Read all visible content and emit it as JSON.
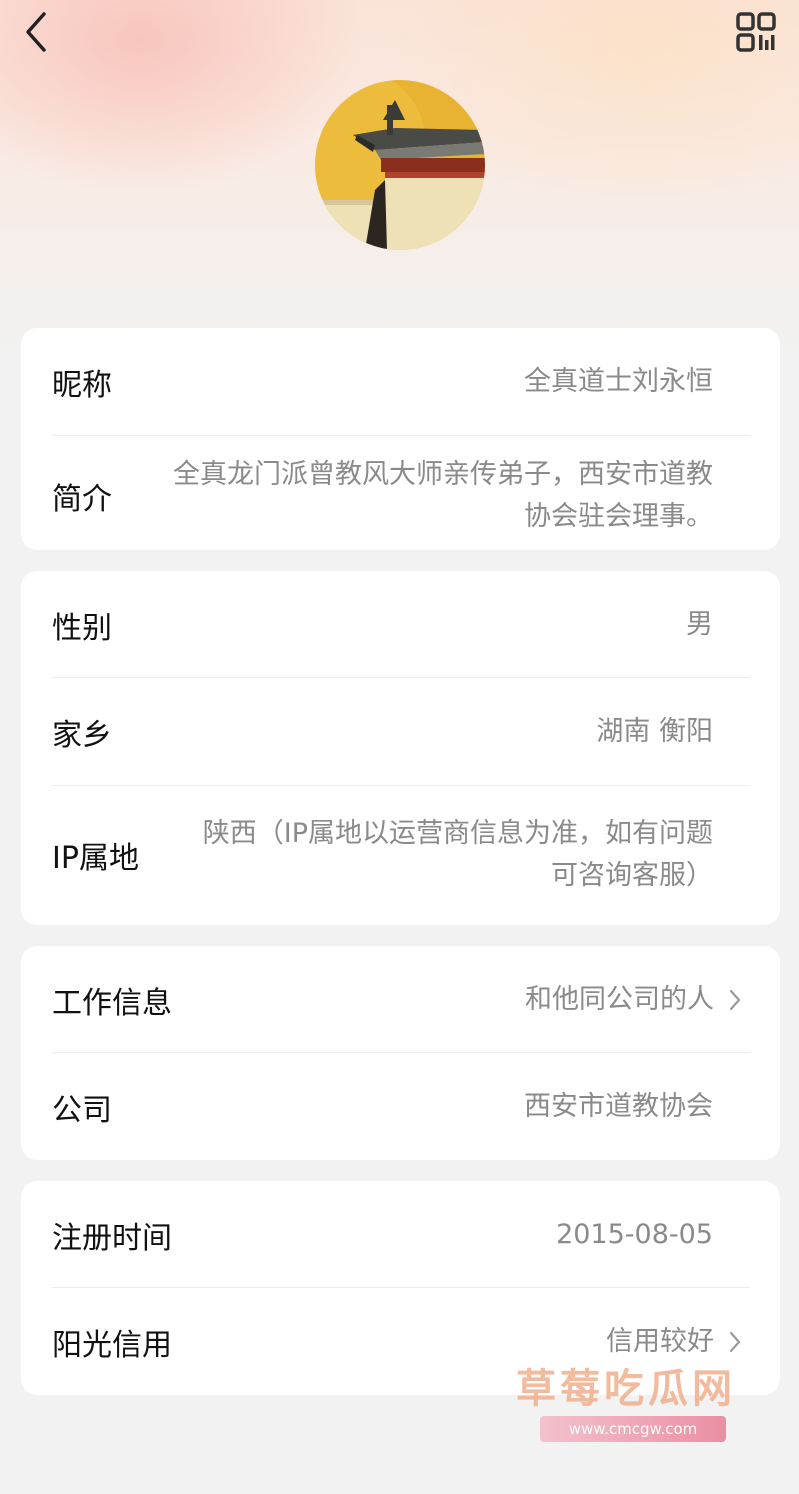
{
  "profile": {
    "nickname_label": "昵称",
    "nickname_value": "全真道士刘永恒",
    "bio_label": "简介",
    "bio_value": "全真龙门派曾教风大师亲传弟子，西安市道教协会驻会理事。"
  },
  "personal": {
    "gender_label": "性别",
    "gender_value": "男",
    "hometown_label": "家乡",
    "hometown_value": "湖南 衡阳",
    "ip_label": "IP属地",
    "ip_value": "陕西（IP属地以运营商信息为准，如有问题可咨询客服）"
  },
  "work": {
    "work_label": "工作信息",
    "work_value": "和他同公司的人",
    "company_label": "公司",
    "company_value": "西安市道教协会"
  },
  "account": {
    "register_label": "注册时间",
    "register_value": "2015-08-05",
    "credit_label": "阳光信用",
    "credit_value": "信用较好"
  },
  "watermark": {
    "text": "草莓吃瓜网",
    "url": "www.cmcgw.com"
  },
  "icons": {
    "back": "chevron-left-icon",
    "qr": "qr-code-icon",
    "chevron": "chevron-right-icon"
  },
  "colors": {
    "value_text": "#8a8a8a",
    "label_text": "#111111",
    "card_bg": "#ffffff",
    "page_bg": "#f2f2f2"
  }
}
